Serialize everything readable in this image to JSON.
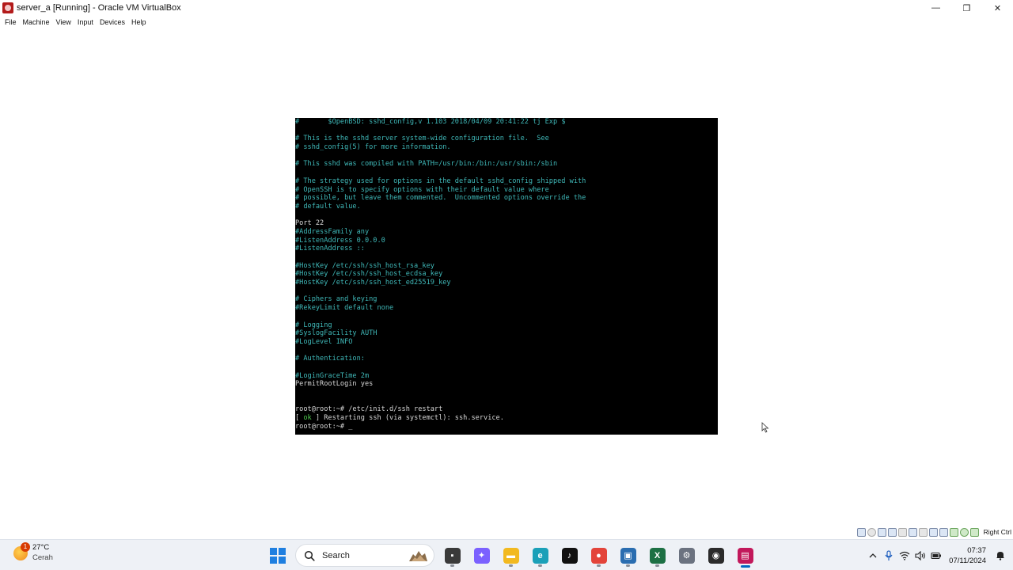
{
  "window": {
    "title": "server_a [Running] - Oracle VM VirtualBox",
    "minimize_glyph": "—",
    "restore_glyph": "❐",
    "close_glyph": "✕"
  },
  "menu": {
    "items": [
      "File",
      "Machine",
      "View",
      "Input",
      "Devices",
      "Help"
    ]
  },
  "terminal": {
    "lines": [
      {
        "text": "#\t$OpenBSD: sshd_config,v 1.103 2018/04/09 20:41:22 tj Exp $",
        "kind": "comment"
      },
      {
        "text": "",
        "kind": "normal"
      },
      {
        "text": "# This is the sshd server system-wide configuration file.  See",
        "kind": "comment"
      },
      {
        "text": "# sshd_config(5) for more information.",
        "kind": "comment"
      },
      {
        "text": "",
        "kind": "normal"
      },
      {
        "text": "# This sshd was compiled with PATH=/usr/bin:/bin:/usr/sbin:/sbin",
        "kind": "comment"
      },
      {
        "text": "",
        "kind": "normal"
      },
      {
        "text": "# The strategy used for options in the default sshd_config shipped with",
        "kind": "comment"
      },
      {
        "text": "# OpenSSH is to specify options with their default value where",
        "kind": "comment"
      },
      {
        "text": "# possible, but leave them commented.  Uncommented options override the",
        "kind": "comment"
      },
      {
        "text": "# default value.",
        "kind": "comment"
      },
      {
        "text": "",
        "kind": "normal"
      },
      {
        "text": "Port 22",
        "kind": "normal"
      },
      {
        "text": "#AddressFamily any",
        "kind": "comment"
      },
      {
        "text": "#ListenAddress 0.0.0.0",
        "kind": "comment"
      },
      {
        "text": "#ListenAddress ::",
        "kind": "comment"
      },
      {
        "text": "",
        "kind": "normal"
      },
      {
        "text": "#HostKey /etc/ssh/ssh_host_rsa_key",
        "kind": "comment"
      },
      {
        "text": "#HostKey /etc/ssh/ssh_host_ecdsa_key",
        "kind": "comment"
      },
      {
        "text": "#HostKey /etc/ssh/ssh_host_ed25519_key",
        "kind": "comment"
      },
      {
        "text": "",
        "kind": "normal"
      },
      {
        "text": "# Ciphers and keying",
        "kind": "comment"
      },
      {
        "text": "#RekeyLimit default none",
        "kind": "comment"
      },
      {
        "text": "",
        "kind": "normal"
      },
      {
        "text": "# Logging",
        "kind": "comment"
      },
      {
        "text": "#SyslogFacility AUTH",
        "kind": "comment"
      },
      {
        "text": "#LogLevel INFO",
        "kind": "comment"
      },
      {
        "text": "",
        "kind": "normal"
      },
      {
        "text": "# Authentication:",
        "kind": "comment"
      },
      {
        "text": "",
        "kind": "normal"
      },
      {
        "text": "#LoginGraceTime 2m",
        "kind": "comment"
      },
      {
        "text": "PermitRootLogin yes",
        "kind": "normal"
      },
      {
        "text": "",
        "kind": "normal"
      },
      {
        "text": "",
        "kind": "normal"
      },
      {
        "text": "root@root:~# /etc/init.d/ssh restart",
        "kind": "normal"
      }
    ],
    "ok_line": {
      "open": "[ ",
      "ok": "ok",
      "rest": " ] Restarting ssh (via systemctl): ssh.service."
    },
    "prompt_line": "root@root:~# _"
  },
  "vbox_status": {
    "host_key_label": "Right Ctrl"
  },
  "taskbar": {
    "weather": {
      "temp": "27°C",
      "desc": "Cerah",
      "badge": "1"
    },
    "search_label": "Search",
    "apps": [
      {
        "name": "file-manager-icon",
        "color": "#3a3a3a",
        "glyph": "▪",
        "state": "running"
      },
      {
        "name": "copilot-icon",
        "color": "#7b61ff",
        "glyph": "✦",
        "state": "none"
      },
      {
        "name": "file-explorer-icon",
        "color": "#f2b91f",
        "glyph": "▬",
        "state": "running"
      },
      {
        "name": "edge-icon",
        "color": "#1aa0b8",
        "glyph": "e",
        "state": "running"
      },
      {
        "name": "tiktok-icon",
        "color": "#111111",
        "glyph": "♪",
        "state": "none"
      },
      {
        "name": "chrome-icon",
        "color": "#e3443a",
        "glyph": "●",
        "state": "running"
      },
      {
        "name": "virtualbox-manager-icon",
        "color": "#2a6db0",
        "glyph": "▣",
        "state": "running"
      },
      {
        "name": "excel-icon",
        "color": "#1d7044",
        "glyph": "X",
        "state": "running"
      },
      {
        "name": "settings-icon",
        "color": "#6b7280",
        "glyph": "⚙",
        "state": "none"
      },
      {
        "name": "obs-icon",
        "color": "#2b2b2b",
        "glyph": "◉",
        "state": "none"
      },
      {
        "name": "server-vm-icon",
        "color": "#c2185b",
        "glyph": "▤",
        "state": "active"
      }
    ],
    "clock": {
      "time": "07:37",
      "date": "07/11/2024"
    }
  }
}
